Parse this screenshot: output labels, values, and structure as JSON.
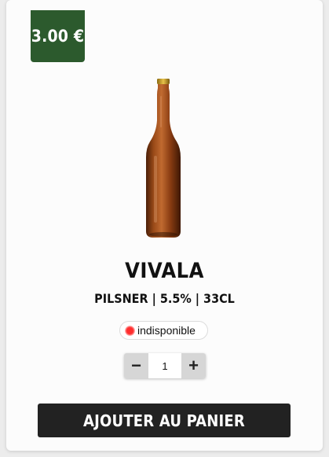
{
  "product": {
    "price": "3.00 €",
    "name": "VIVALA",
    "specs": "PILSNER | 5.5% | 33CL",
    "availability": "indisponible",
    "image_icon": "beer-bottle-image"
  },
  "quantity": {
    "decrement_label": "−",
    "value": "1",
    "increment_label": "+"
  },
  "cart": {
    "add_label": "AJOUTER AU PANIER"
  },
  "colors": {
    "price_badge": "#2c5a2d",
    "add_button": "#222222",
    "status_unavailable": "#ff2a2a",
    "bottle": "#8a3d12"
  }
}
